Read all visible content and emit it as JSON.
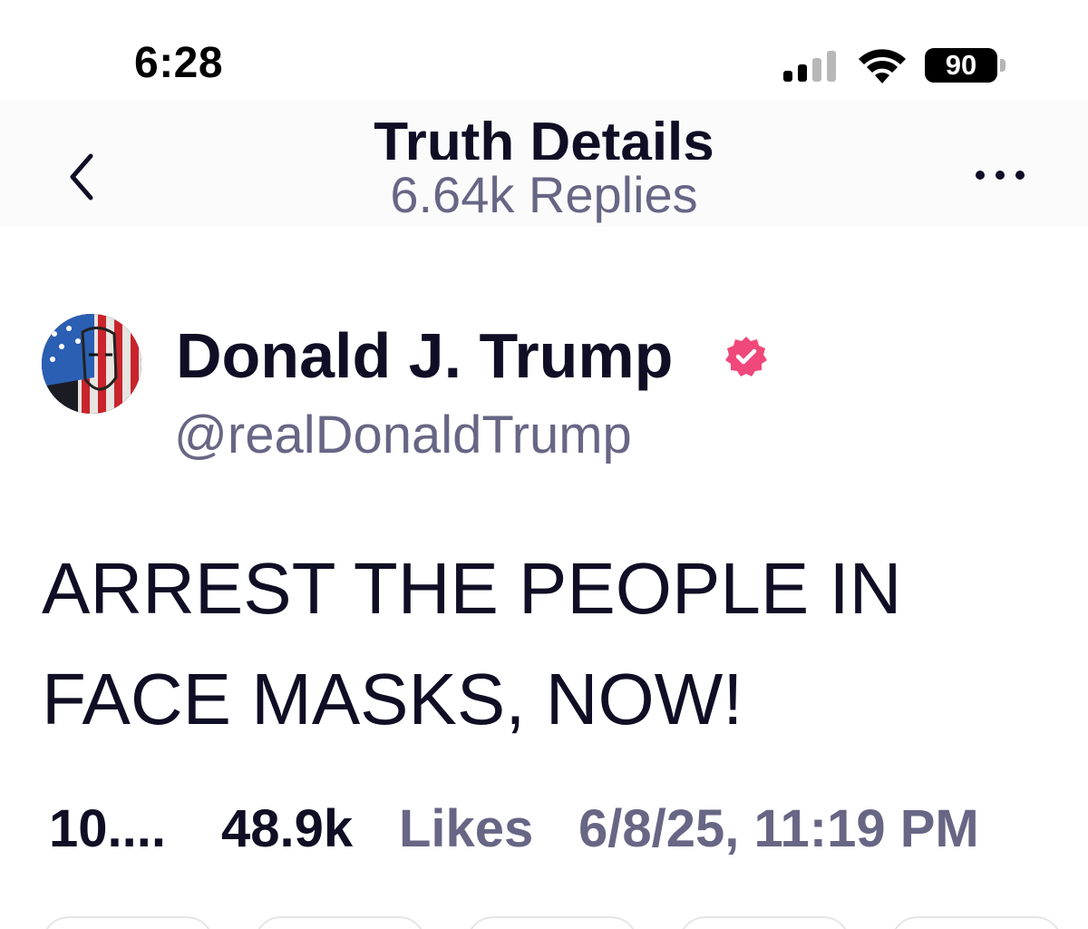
{
  "status_bar": {
    "time": "6:28",
    "battery_level": "90",
    "icons": [
      "cellular-signal-icon",
      "wifi-icon",
      "battery-icon"
    ]
  },
  "header": {
    "title": "Truth Details",
    "subtitle": "6.64k Replies",
    "back_icon": "chevron-left-icon",
    "more_icon": "ellipsis-icon"
  },
  "author": {
    "name": "Donald J. Trump",
    "handle": "@realDonaldTrump",
    "verified_icon": "verified-badge-icon",
    "verified_color": "#f0487a"
  },
  "post": {
    "text": "ARREST THE PEOPLE IN FACE MASKS, NOW!"
  },
  "stats": {
    "replies": "10....",
    "likes_count": "48.9k",
    "likes_label": "Likes",
    "timestamp": "6/8/25, 11:19 PM"
  },
  "colors": {
    "text_primary": "#0f0e25",
    "text_secondary": "#676685",
    "header_bg": "#fbfbfc"
  }
}
